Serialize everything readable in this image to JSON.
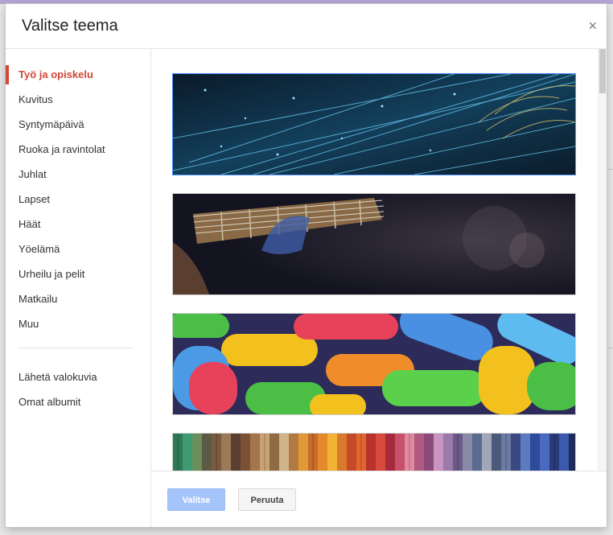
{
  "dialog": {
    "title": "Valitse teema",
    "close_icon": "close-icon",
    "close_glyph": "×"
  },
  "sidebar": {
    "categories": [
      {
        "label": "Työ ja opiskelu",
        "active": true
      },
      {
        "label": "Kuvitus"
      },
      {
        "label": "Syntymäpäivä"
      },
      {
        "label": "Ruoka ja ravintolat"
      },
      {
        "label": "Juhlat"
      },
      {
        "label": "Lapset"
      },
      {
        "label": "Häät"
      },
      {
        "label": "Yöelämä"
      },
      {
        "label": "Urheilu ja pelit"
      },
      {
        "label": "Matkailu"
      },
      {
        "label": "Muu"
      }
    ],
    "extras": [
      {
        "label": "Lähetä valokuvia"
      },
      {
        "label": "Omat albumit"
      }
    ]
  },
  "themes": [
    {
      "name": "fiber-optic-theme",
      "selected": true
    },
    {
      "name": "guitar-theme"
    },
    {
      "name": "candy-theme"
    },
    {
      "name": "yarn-theme"
    }
  ],
  "footer": {
    "select_label": "Valitse",
    "cancel_label": "Peruuta"
  },
  "colors": {
    "accent": "#d14836",
    "primary_button": "#a5c4f9",
    "selected_border": "#4d90fe"
  }
}
